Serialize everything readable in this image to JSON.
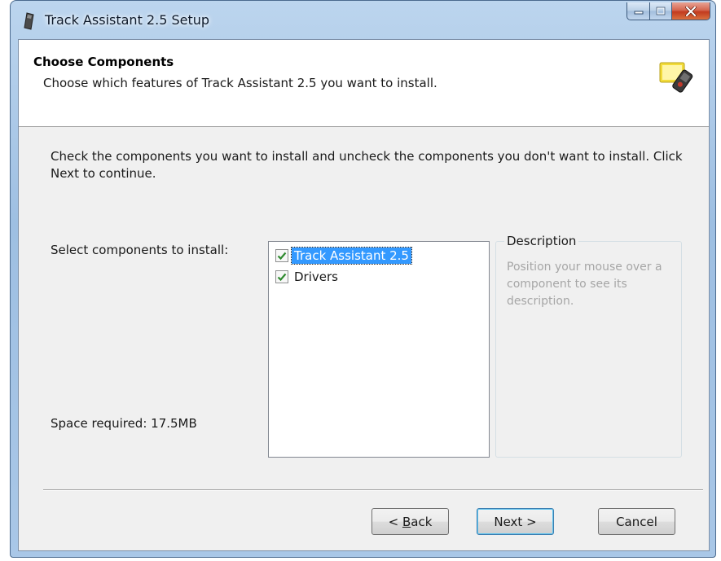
{
  "window": {
    "title": "Track Assistant 2.5 Setup"
  },
  "header": {
    "title": "Choose Components",
    "subtitle": "Choose which features of Track Assistant 2.5 you want to install."
  },
  "body": {
    "intro": "Check the components you want to install and uncheck the components you don't want to install. Click Next to continue.",
    "select_label": "Select components to install:",
    "space_required": "Space required: 17.5MB"
  },
  "components": [
    {
      "label": "Track Assistant 2.5",
      "checked": true,
      "selected": true
    },
    {
      "label": "Drivers",
      "checked": true,
      "selected": false
    }
  ],
  "description": {
    "legend": "Description",
    "text": "Position your mouse over a component to see its description."
  },
  "buttons": {
    "back_prefix": "< ",
    "back_accel": "B",
    "back_rest": "ack",
    "next": "Next >",
    "cancel": "Cancel"
  },
  "icons": {
    "app": "usb-drive-icon",
    "header": "gps-device-icon",
    "check": "checkmark-icon"
  },
  "colors": {
    "selection": "#3399ff",
    "check": "#2f8a2f",
    "close_button": "#c23a1f"
  }
}
